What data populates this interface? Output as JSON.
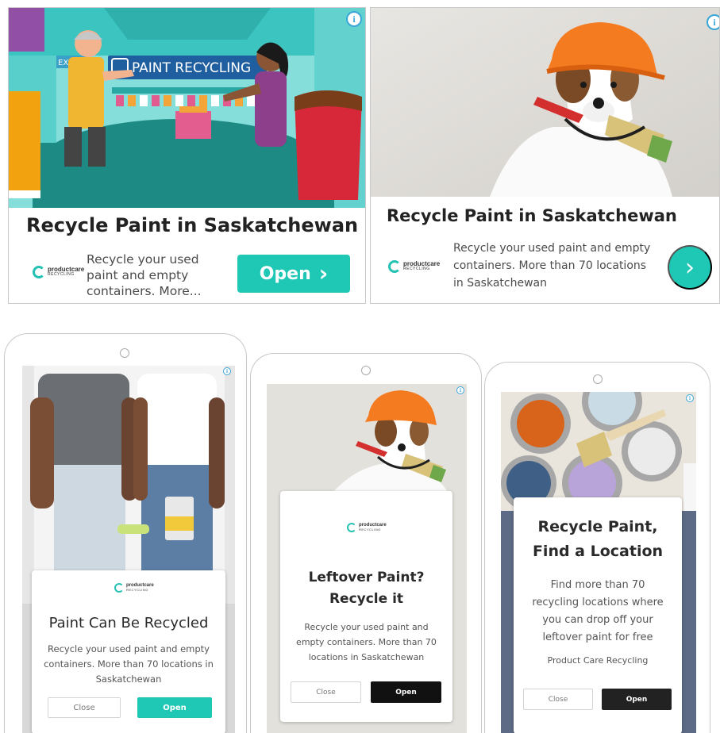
{
  "banner_left": {
    "title": "Recycle Paint in Saskatchewan",
    "description": "Recycle your used paint and empty containers. More...",
    "open_label": "Open",
    "open_chevron": "›",
    "info_glyph": "i",
    "scene_sign": "PAINT RECYCLING",
    "scene_exit": "EXI",
    "logo": {
      "name": "productcare",
      "sub": "RECYCLING"
    }
  },
  "banner_right": {
    "title": "Recycle Paint in Saskatchewan",
    "description": "Recycle your used paint and empty containers. More than 70 locations in Saskatchewan",
    "chevron": "›",
    "info_glyph": "i",
    "logo": {
      "name": "productcare",
      "sub": "RECYCLING"
    }
  },
  "phone_1": {
    "title": "Paint Can Be Recycled",
    "description": "Recycle your used paint and empty containers. More than 70 locations in Saskatchewan",
    "close_label": "Close",
    "open_label": "Open",
    "info_glyph": "i",
    "logo": {
      "name": "productcare",
      "sub": "RECYCLING"
    }
  },
  "phone_2": {
    "title_line1": "Leftover Paint?",
    "title_line2": "Recycle it",
    "description": "Recycle your used paint and empty containers. More than 70 locations in Saskatchewan",
    "close_label": "Close",
    "open_label": "Open",
    "info_glyph": "i",
    "logo": {
      "name": "productcare",
      "sub": "RECYCLING"
    }
  },
  "phone_3": {
    "title_line1": "Recycle Paint,",
    "title_line2": "Find a Location",
    "description": "Find more than 70 recycling locations where you can drop off your leftover paint for free",
    "brand": "Product Care Recycling",
    "close_label": "Close",
    "open_label": "Open",
    "info_glyph": "i"
  },
  "colors": {
    "accent_teal": "#1ec8b4",
    "open_dark": "#111111",
    "info_blue": "#3aa6d8",
    "helmet_orange": "#f47b20"
  }
}
